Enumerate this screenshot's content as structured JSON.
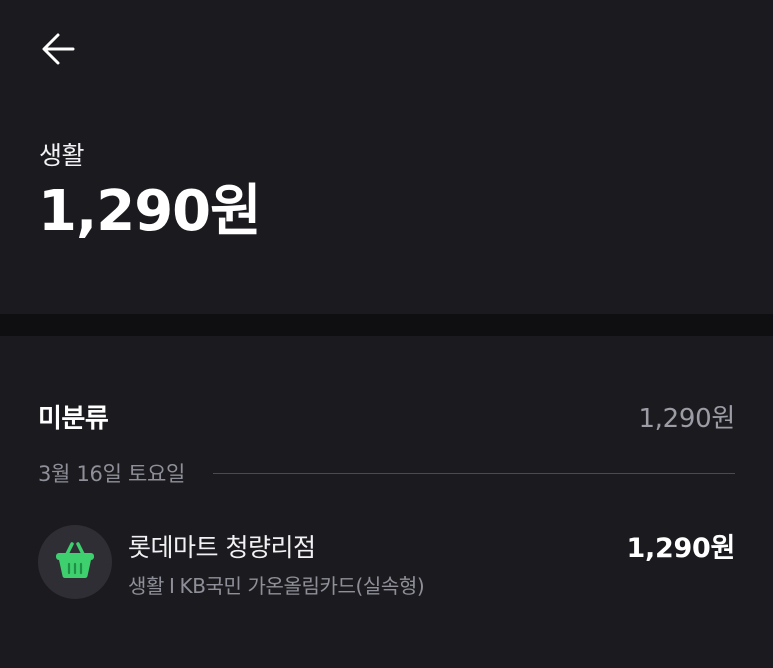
{
  "header": {
    "back_icon": "arrow-left-icon",
    "category": "생활",
    "total_amount": "1,290원"
  },
  "section": {
    "title": "미분류",
    "total": "1,290원",
    "date": "3월 16일 토요일",
    "transactions": [
      {
        "icon": "shopping-basket-icon",
        "icon_color": "#3ecf6e",
        "merchant": "롯데마트 청량리점",
        "category": "생활",
        "separator": "I",
        "card": "KB국민 가온올림카드(실속형)",
        "amount": "1,290원"
      }
    ]
  },
  "colors": {
    "background": "#1b1b1f",
    "divider": "#0f0f11",
    "primary_text": "#ffffff",
    "secondary_text": "#8f8f99",
    "accent_green": "#3ecf6e"
  }
}
